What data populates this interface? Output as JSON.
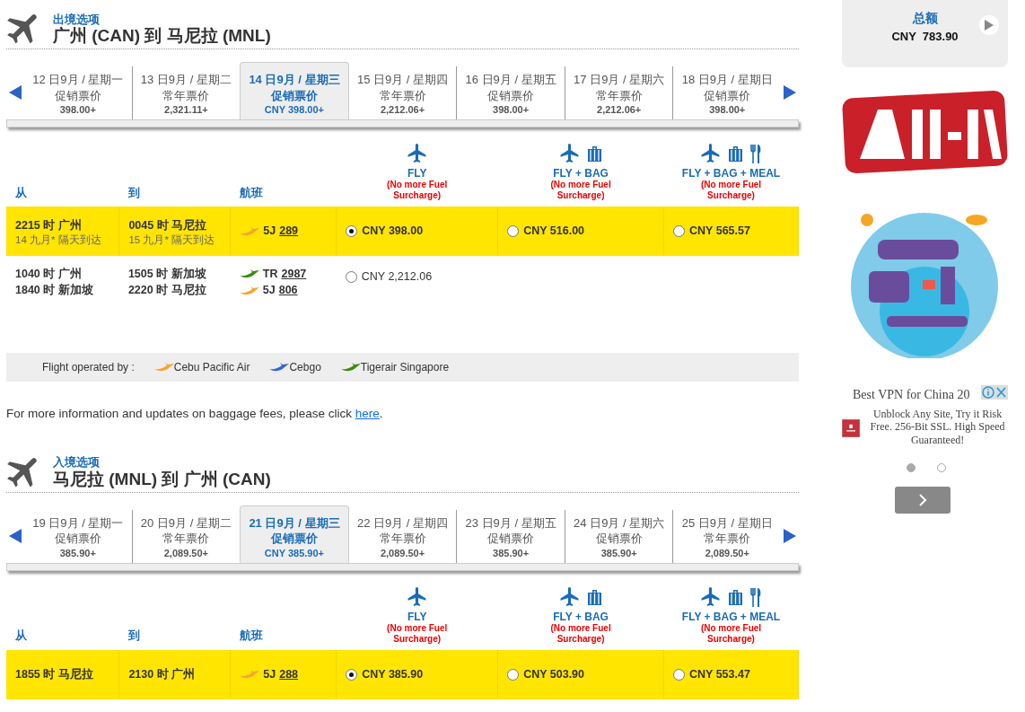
{
  "sections": [
    {
      "label": "出境选项",
      "route": "广州 (CAN) 到 马尼拉 (MNL)",
      "dates": [
        {
          "date": "12 日9月 / 星期一",
          "fare_type": "促销票价",
          "price": "398.00+",
          "selected": false
        },
        {
          "date": "13 日9月 / 星期二",
          "fare_type": "常年票价",
          "price": "2,321.11+",
          "selected": false
        },
        {
          "date": "14 日9月 / 星期三",
          "fare_type": "促销票价",
          "price": "CNY 398.00+",
          "selected": true
        },
        {
          "date": "15 日9月 / 星期四",
          "fare_type": "常年票价",
          "price": "2,212.06+",
          "selected": false
        },
        {
          "date": "16 日9月 / 星期五",
          "fare_type": "促销票价",
          "price": "398.00+",
          "selected": false
        },
        {
          "date": "17 日9月 / 星期六",
          "fare_type": "常年票价",
          "price": "2,212.06+",
          "selected": false
        },
        {
          "date": "18 日9月 / 星期日",
          "fare_type": "促销票价",
          "price": "398.00+",
          "selected": false
        }
      ],
      "columns": [
        "从",
        "到",
        "航班"
      ],
      "fare_columns": [
        {
          "kind": "fly",
          "title": "FLY",
          "note": "(No more Fuel Surcharge)"
        },
        {
          "kind": "fly_bag",
          "title": "FLY + BAG",
          "note": "(No more Fuel Surcharge)"
        },
        {
          "kind": "fly_bag_meal",
          "title": "FLY + BAG + MEAL",
          "note": "(No more Fuel Surcharge)"
        }
      ],
      "flights": [
        {
          "highlighted": true,
          "legs": [
            {
              "depart": "2215 时 广州",
              "depart_note": "14 九月*  隔天到达",
              "arrive": "0045 时 马尼拉",
              "arrive_note": "15 九月*  隔天到达",
              "color": "#f7a433",
              "carrier": "5J",
              "number": "289"
            }
          ],
          "fares": [
            {
              "price": "CNY 398.00",
              "selected": true
            },
            {
              "price": "CNY 516.00",
              "selected": false
            },
            {
              "price": "CNY 565.57",
              "selected": false
            }
          ]
        },
        {
          "highlighted": false,
          "legs": [
            {
              "depart": "1040 时 广州",
              "arrive": "1505 时 新加坡",
              "color": "#3d8a10",
              "carrier": "TR",
              "number": "2987"
            },
            {
              "depart": "1840 时 新加坡",
              "arrive": "2220 时 马尼拉",
              "color": "#f7a433",
              "carrier": "5J",
              "number": "806"
            }
          ],
          "fares": [
            {
              "price": "CNY 2,212.06",
              "selected": false
            }
          ]
        }
      ],
      "operated_by": {
        "label": "Flight operated by :",
        "operators": [
          {
            "name": "Cebu Pacific Air",
            "color": "#f7a433"
          },
          {
            "name": "Cebgo",
            "color": "#3466d6"
          },
          {
            "name": "Tigerair Singapore",
            "color": "#3d8a10"
          }
        ]
      },
      "baggage_note": {
        "text": "For more information and updates on baggage fees, please click ",
        "link": "here",
        "end": "."
      }
    },
    {
      "label": "入境选项",
      "route": "马尼拉 (MNL) 到 广州 (CAN)",
      "dates": [
        {
          "date": "19 日9月 / 星期一",
          "fare_type": "促销票价",
          "price": "385.90+",
          "selected": false
        },
        {
          "date": "20 日9月 / 星期二",
          "fare_type": "常年票价",
          "price": "2,089.50+",
          "selected": false
        },
        {
          "date": "21 日9月 / 星期三",
          "fare_type": "促销票价",
          "price": "CNY 385.90+",
          "selected": true
        },
        {
          "date": "22 日9月 / 星期四",
          "fare_type": "常年票价",
          "price": "2,089.50+",
          "selected": false
        },
        {
          "date": "23 日9月 / 星期五",
          "fare_type": "促销票价",
          "price": "385.90+",
          "selected": false
        },
        {
          "date": "24 日9月 / 星期六",
          "fare_type": "促销票价",
          "price": "385.90+",
          "selected": false
        },
        {
          "date": "25 日9月 / 星期日",
          "fare_type": "常年票价",
          "price": "2,089.50+",
          "selected": false
        }
      ],
      "columns": [
        "从",
        "到",
        "航班"
      ],
      "fare_columns": [
        {
          "kind": "fly",
          "title": "FLY",
          "note": "(No more Fuel Surcharge)"
        },
        {
          "kind": "fly_bag",
          "title": "FLY + BAG",
          "note": "(No more Fuel Surcharge)"
        },
        {
          "kind": "fly_bag_meal",
          "title": "FLY + BAG + MEAL",
          "note": "(No more Fuel Surcharge)"
        }
      ],
      "flights": [
        {
          "highlighted": true,
          "legs": [
            {
              "depart": "1855 时 马尼拉",
              "arrive": "2130 时 广州",
              "color": "#f7a433",
              "carrier": "5J",
              "number": "288"
            }
          ],
          "fares": [
            {
              "price": "CNY 385.90",
              "selected": true
            },
            {
              "price": "CNY 503.90",
              "selected": false
            },
            {
              "price": "CNY 553.47",
              "selected": false
            }
          ]
        }
      ]
    }
  ],
  "total": {
    "label": "总额",
    "amount": "CNY  783.90"
  },
  "vpn_ad": {
    "title": "Best VPN for China 20",
    "body": "Unblock Any Site, Try it Risk Free. 256-Bit SSL. High Speed Guaranteed!",
    "dots": [
      {
        "selected": true
      },
      {
        "selected": false
      }
    ]
  }
}
